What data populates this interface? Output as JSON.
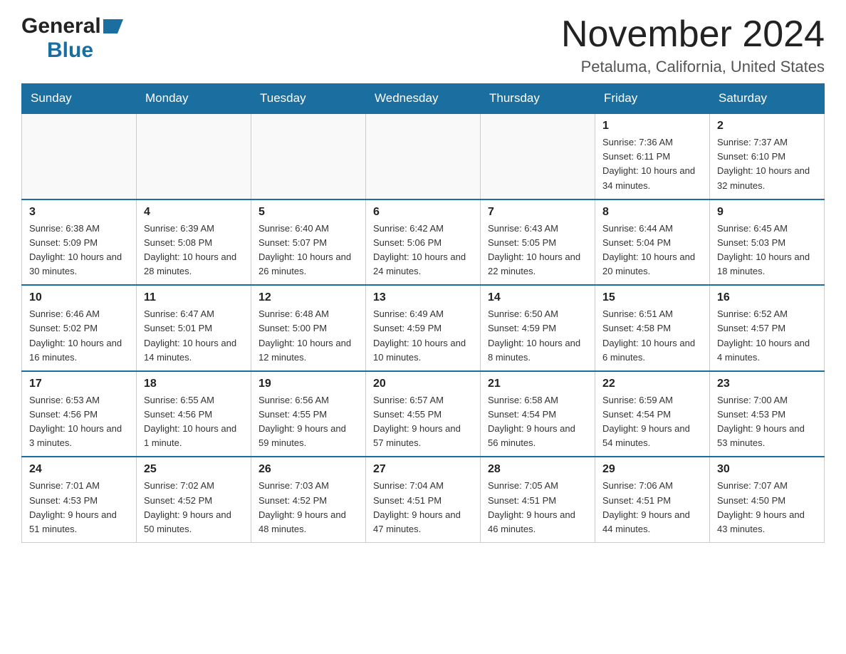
{
  "logo": {
    "general": "General",
    "blue": "Blue"
  },
  "header": {
    "month": "November 2024",
    "location": "Petaluma, California, United States"
  },
  "days_of_week": [
    "Sunday",
    "Monday",
    "Tuesday",
    "Wednesday",
    "Thursday",
    "Friday",
    "Saturday"
  ],
  "weeks": [
    [
      {
        "day": "",
        "info": ""
      },
      {
        "day": "",
        "info": ""
      },
      {
        "day": "",
        "info": ""
      },
      {
        "day": "",
        "info": ""
      },
      {
        "day": "",
        "info": ""
      },
      {
        "day": "1",
        "info": "Sunrise: 7:36 AM\nSunset: 6:11 PM\nDaylight: 10 hours and 34 minutes."
      },
      {
        "day": "2",
        "info": "Sunrise: 7:37 AM\nSunset: 6:10 PM\nDaylight: 10 hours and 32 minutes."
      }
    ],
    [
      {
        "day": "3",
        "info": "Sunrise: 6:38 AM\nSunset: 5:09 PM\nDaylight: 10 hours and 30 minutes."
      },
      {
        "day": "4",
        "info": "Sunrise: 6:39 AM\nSunset: 5:08 PM\nDaylight: 10 hours and 28 minutes."
      },
      {
        "day": "5",
        "info": "Sunrise: 6:40 AM\nSunset: 5:07 PM\nDaylight: 10 hours and 26 minutes."
      },
      {
        "day": "6",
        "info": "Sunrise: 6:42 AM\nSunset: 5:06 PM\nDaylight: 10 hours and 24 minutes."
      },
      {
        "day": "7",
        "info": "Sunrise: 6:43 AM\nSunset: 5:05 PM\nDaylight: 10 hours and 22 minutes."
      },
      {
        "day": "8",
        "info": "Sunrise: 6:44 AM\nSunset: 5:04 PM\nDaylight: 10 hours and 20 minutes."
      },
      {
        "day": "9",
        "info": "Sunrise: 6:45 AM\nSunset: 5:03 PM\nDaylight: 10 hours and 18 minutes."
      }
    ],
    [
      {
        "day": "10",
        "info": "Sunrise: 6:46 AM\nSunset: 5:02 PM\nDaylight: 10 hours and 16 minutes."
      },
      {
        "day": "11",
        "info": "Sunrise: 6:47 AM\nSunset: 5:01 PM\nDaylight: 10 hours and 14 minutes."
      },
      {
        "day": "12",
        "info": "Sunrise: 6:48 AM\nSunset: 5:00 PM\nDaylight: 10 hours and 12 minutes."
      },
      {
        "day": "13",
        "info": "Sunrise: 6:49 AM\nSunset: 4:59 PM\nDaylight: 10 hours and 10 minutes."
      },
      {
        "day": "14",
        "info": "Sunrise: 6:50 AM\nSunset: 4:59 PM\nDaylight: 10 hours and 8 minutes."
      },
      {
        "day": "15",
        "info": "Sunrise: 6:51 AM\nSunset: 4:58 PM\nDaylight: 10 hours and 6 minutes."
      },
      {
        "day": "16",
        "info": "Sunrise: 6:52 AM\nSunset: 4:57 PM\nDaylight: 10 hours and 4 minutes."
      }
    ],
    [
      {
        "day": "17",
        "info": "Sunrise: 6:53 AM\nSunset: 4:56 PM\nDaylight: 10 hours and 3 minutes."
      },
      {
        "day": "18",
        "info": "Sunrise: 6:55 AM\nSunset: 4:56 PM\nDaylight: 10 hours and 1 minute."
      },
      {
        "day": "19",
        "info": "Sunrise: 6:56 AM\nSunset: 4:55 PM\nDaylight: 9 hours and 59 minutes."
      },
      {
        "day": "20",
        "info": "Sunrise: 6:57 AM\nSunset: 4:55 PM\nDaylight: 9 hours and 57 minutes."
      },
      {
        "day": "21",
        "info": "Sunrise: 6:58 AM\nSunset: 4:54 PM\nDaylight: 9 hours and 56 minutes."
      },
      {
        "day": "22",
        "info": "Sunrise: 6:59 AM\nSunset: 4:54 PM\nDaylight: 9 hours and 54 minutes."
      },
      {
        "day": "23",
        "info": "Sunrise: 7:00 AM\nSunset: 4:53 PM\nDaylight: 9 hours and 53 minutes."
      }
    ],
    [
      {
        "day": "24",
        "info": "Sunrise: 7:01 AM\nSunset: 4:53 PM\nDaylight: 9 hours and 51 minutes."
      },
      {
        "day": "25",
        "info": "Sunrise: 7:02 AM\nSunset: 4:52 PM\nDaylight: 9 hours and 50 minutes."
      },
      {
        "day": "26",
        "info": "Sunrise: 7:03 AM\nSunset: 4:52 PM\nDaylight: 9 hours and 48 minutes."
      },
      {
        "day": "27",
        "info": "Sunrise: 7:04 AM\nSunset: 4:51 PM\nDaylight: 9 hours and 47 minutes."
      },
      {
        "day": "28",
        "info": "Sunrise: 7:05 AM\nSunset: 4:51 PM\nDaylight: 9 hours and 46 minutes."
      },
      {
        "day": "29",
        "info": "Sunrise: 7:06 AM\nSunset: 4:51 PM\nDaylight: 9 hours and 44 minutes."
      },
      {
        "day": "30",
        "info": "Sunrise: 7:07 AM\nSunset: 4:50 PM\nDaylight: 9 hours and 43 minutes."
      }
    ]
  ]
}
